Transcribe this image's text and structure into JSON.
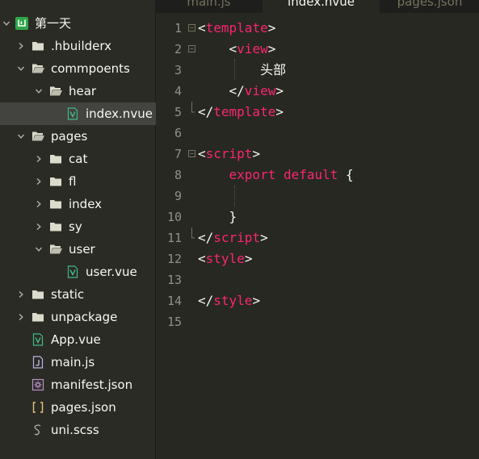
{
  "colors": {
    "background": "#272822",
    "sidebar_background": "#2b2b26",
    "selected_row": "#434340",
    "tag_color": "#f92672",
    "text_color": "#f8f8f2",
    "line_number_color": "#90908a",
    "hbuilder_logo_green": "#2fa64a",
    "vue_icon_green": "#41b883"
  },
  "sidebar": {
    "project_title": "第一天",
    "items": [
      {
        "label": ".hbuilderx",
        "type": "folder",
        "expanded": false,
        "icon": "folder-icon"
      },
      {
        "label": "commpoents",
        "type": "folder",
        "expanded": true,
        "icon": "folder-open-icon"
      },
      {
        "label": "hear",
        "type": "folder",
        "expanded": true,
        "icon": "folder-open-icon"
      },
      {
        "label": "index.nvue",
        "type": "file",
        "icon": "vue-file-icon",
        "selected": true
      },
      {
        "label": "pages",
        "type": "folder",
        "expanded": true,
        "icon": "folder-open-icon"
      },
      {
        "label": "cat",
        "type": "folder",
        "expanded": false,
        "icon": "folder-icon"
      },
      {
        "label": "fl",
        "type": "folder",
        "expanded": false,
        "icon": "folder-icon"
      },
      {
        "label": "index",
        "type": "folder",
        "expanded": false,
        "icon": "folder-icon"
      },
      {
        "label": "sy",
        "type": "folder",
        "expanded": false,
        "icon": "folder-icon"
      },
      {
        "label": "user",
        "type": "folder",
        "expanded": true,
        "icon": "folder-open-icon"
      },
      {
        "label": "user.vue",
        "type": "file",
        "icon": "vue-file-icon"
      },
      {
        "label": "static",
        "type": "folder",
        "expanded": false,
        "icon": "folder-icon"
      },
      {
        "label": "unpackage",
        "type": "folder",
        "expanded": false,
        "icon": "folder-icon"
      },
      {
        "label": "App.vue",
        "type": "file",
        "icon": "vue-file-icon"
      },
      {
        "label": "main.js",
        "type": "file",
        "icon": "js-file-icon"
      },
      {
        "label": "manifest.json",
        "type": "file",
        "icon": "manifest-gear-icon"
      },
      {
        "label": "pages.json",
        "type": "file",
        "icon": "json-brackets-icon"
      },
      {
        "label": "uni.scss",
        "type": "file",
        "icon": "scss-file-icon"
      }
    ]
  },
  "tabs": [
    {
      "label": "main.js",
      "active": false
    },
    {
      "label": "index.nvue",
      "active": true
    },
    {
      "label": "pages.json",
      "active": false
    }
  ],
  "editor": {
    "lines": [
      {
        "number": "1",
        "tokens": [
          {
            "t": "p",
            "v": "<"
          },
          {
            "t": "t",
            "v": "template"
          },
          {
            "t": "p",
            "v": ">"
          }
        ]
      },
      {
        "number": "2",
        "tokens": [
          {
            "t": "p",
            "v": "    <"
          },
          {
            "t": "t",
            "v": "view"
          },
          {
            "t": "p",
            "v": ">"
          }
        ]
      },
      {
        "number": "3",
        "tokens": [
          {
            "t": "p",
            "v": "        "
          },
          {
            "t": "cjk",
            "v": "头部"
          }
        ]
      },
      {
        "number": "4",
        "tokens": [
          {
            "t": "p",
            "v": "    </"
          },
          {
            "t": "t",
            "v": "view"
          },
          {
            "t": "p",
            "v": ">"
          }
        ]
      },
      {
        "number": "5",
        "tokens": [
          {
            "t": "p",
            "v": "</"
          },
          {
            "t": "t",
            "v": "template"
          },
          {
            "t": "p",
            "v": ">"
          }
        ]
      },
      {
        "number": "6",
        "tokens": []
      },
      {
        "number": "7",
        "tokens": [
          {
            "t": "p",
            "v": "<"
          },
          {
            "t": "t",
            "v": "script"
          },
          {
            "t": "p",
            "v": ">"
          }
        ]
      },
      {
        "number": "8",
        "tokens": [
          {
            "t": "p",
            "v": "    "
          },
          {
            "t": "t",
            "v": "export default"
          },
          {
            "t": "p",
            "v": " {"
          }
        ]
      },
      {
        "number": "9",
        "tokens": []
      },
      {
        "number": "10",
        "tokens": [
          {
            "t": "p",
            "v": "    }"
          }
        ]
      },
      {
        "number": "11",
        "tokens": [
          {
            "t": "p",
            "v": "</"
          },
          {
            "t": "t",
            "v": "script"
          },
          {
            "t": "p",
            "v": ">"
          }
        ]
      },
      {
        "number": "12",
        "tokens": [
          {
            "t": "p",
            "v": "<"
          },
          {
            "t": "t",
            "v": "style"
          },
          {
            "t": "p",
            "v": ">"
          }
        ]
      },
      {
        "number": "13",
        "tokens": []
      },
      {
        "number": "14",
        "tokens": [
          {
            "t": "p",
            "v": "</"
          },
          {
            "t": "t",
            "v": "style"
          },
          {
            "t": "p",
            "v": ">"
          }
        ]
      },
      {
        "number": "15",
        "tokens": []
      }
    ]
  }
}
